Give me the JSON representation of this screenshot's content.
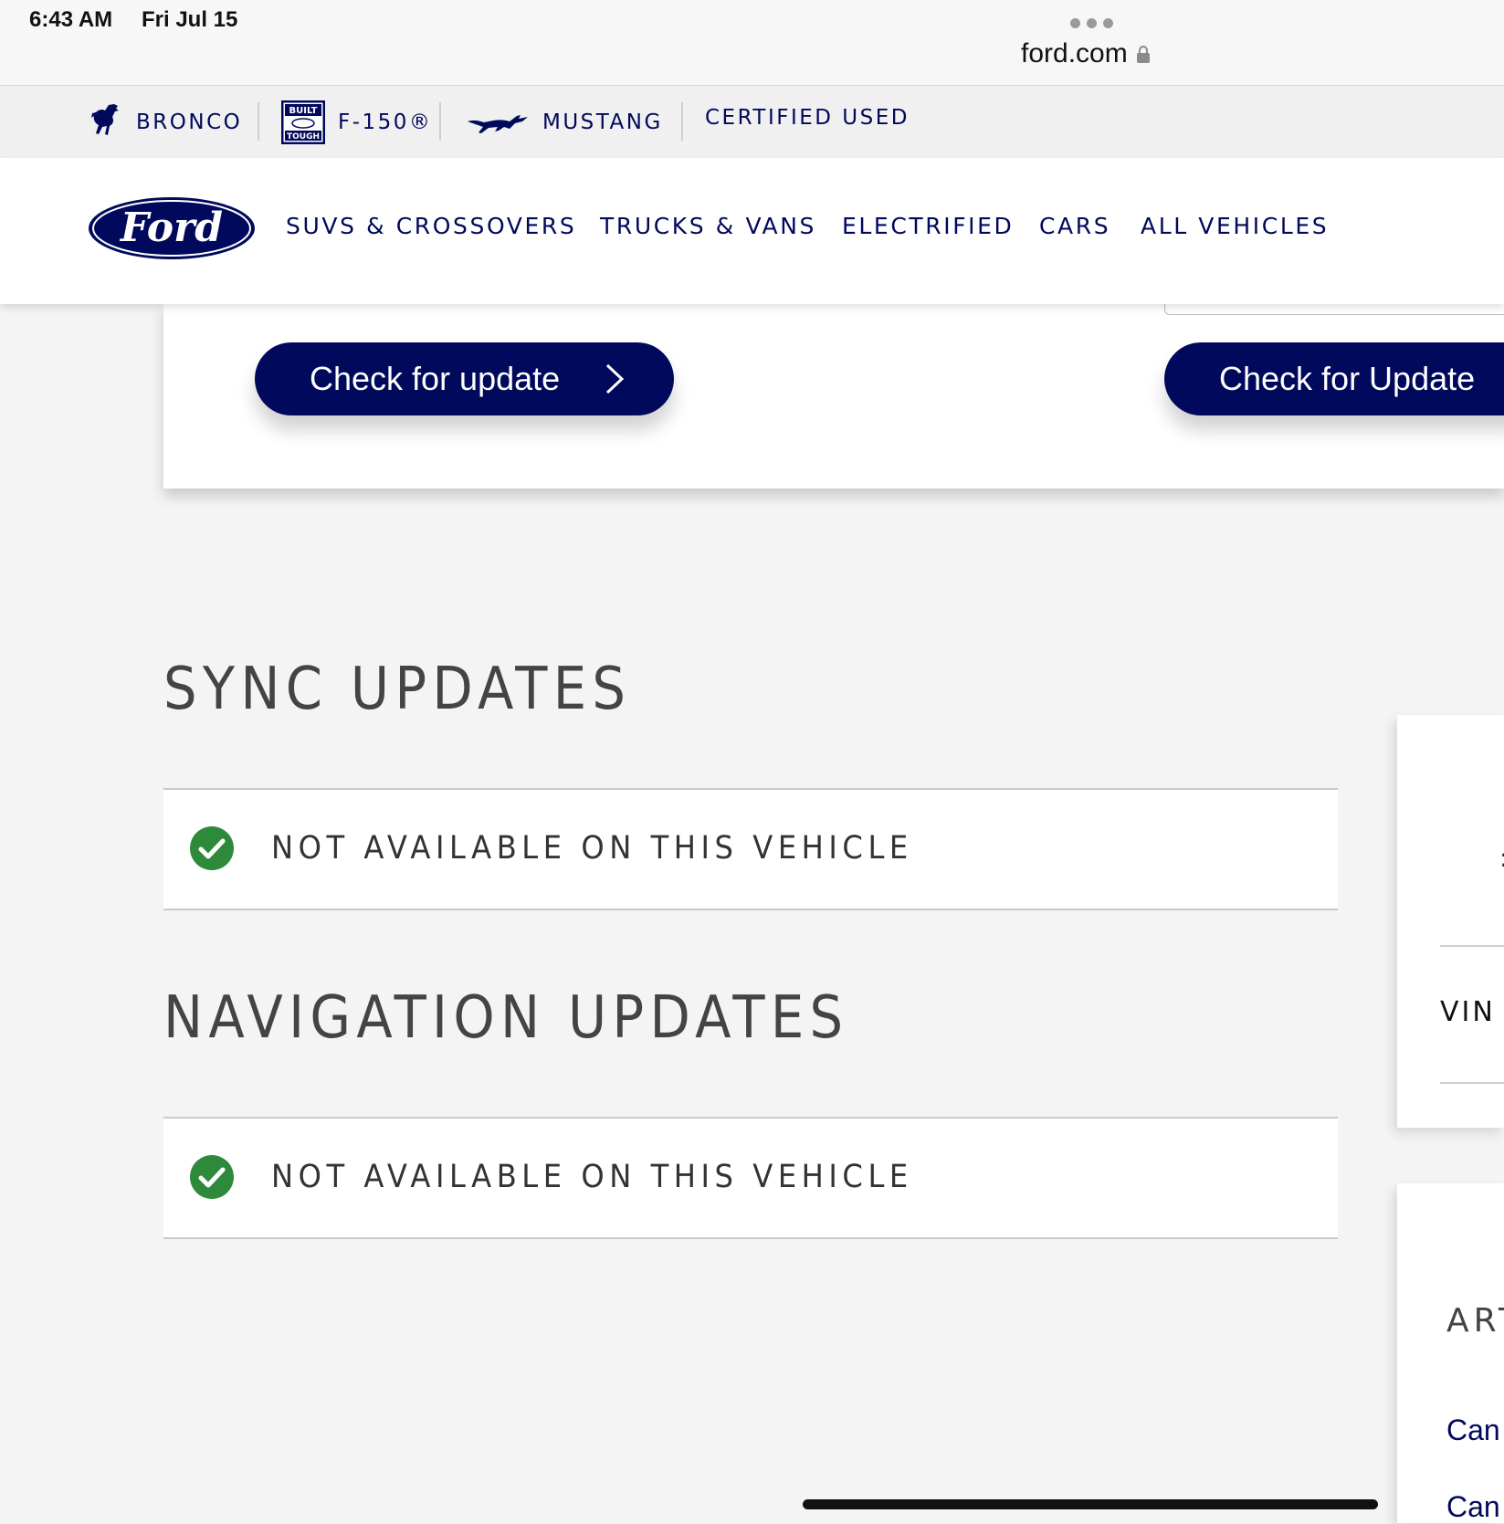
{
  "status_bar": {
    "time": "6:43 AM",
    "date": "Fri Jul 15"
  },
  "browser": {
    "url": "ford.com",
    "menu_icon": "ellipsis-icon",
    "lock_icon": "lock-icon"
  },
  "brand_bar": {
    "items": [
      {
        "label": "BRONCO",
        "icon": "bronco-horse-icon"
      },
      {
        "label": "F-150®",
        "icon": "built-ford-tough-icon"
      },
      {
        "label": "MUSTANG",
        "icon": "mustang-pony-icon"
      },
      {
        "label": "CERTIFIED USED"
      }
    ]
  },
  "main_nav": {
    "logo": "Ford",
    "items": [
      "SUVS & CROSSOVERS",
      "TRUCKS & VANS",
      "ELECTRIFIED",
      "CARS",
      "ALL VEHICLES"
    ]
  },
  "update_card": {
    "button_left": "Check for update",
    "button_right": "Check for Update"
  },
  "sections": [
    {
      "title": "SYNC UPDATES",
      "status": "NOT AVAILABLE ON THIS VEHICLE"
    },
    {
      "title": "NAVIGATION UPDATES",
      "status": "NOT AVAILABLE ON THIS VEHICLE"
    }
  ],
  "side_panel": {
    "card1_fragment": ":",
    "vin_label": "VIN",
    "card2_heading": "ART",
    "links": [
      "Can",
      "Can"
    ]
  },
  "colors": {
    "ford_blue": "#00095b",
    "success_green": "#2d8a3a",
    "page_bg": "#f4f4f4"
  }
}
